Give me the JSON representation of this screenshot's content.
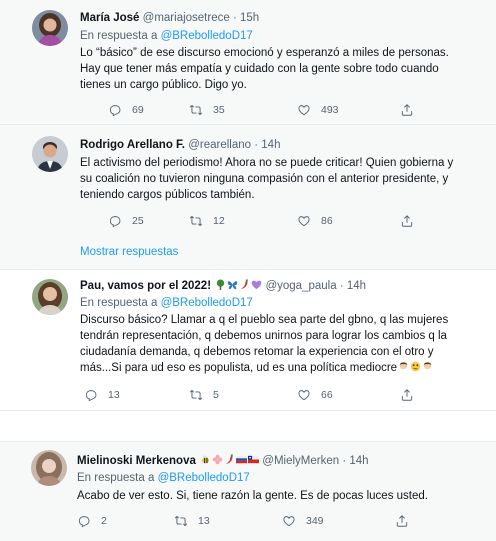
{
  "reply_prefix": "En respuesta a",
  "tweets": [
    {
      "name": "María José",
      "handle": "@mariajosetrece",
      "time": "15h",
      "reply_to": "@BRebolledoD17",
      "lines": [
        "Lo “básico” de ese discurso emocionó y esperanzó a miles de personas.",
        "Hay que tener más empatía y cuidado con la gente sobre todo cuando",
        "tienes un cargo público. Digo yo."
      ],
      "replies": "69",
      "retweets": "35",
      "likes": "493"
    },
    {
      "name": "Rodrigo Arellano F.",
      "handle": "@rearellano",
      "time": "14h",
      "reply_to": null,
      "lines": [
        "El activismo del periodismo! Ahora no se puede criticar! Quien gobierna y",
        "su coalición no tuvieron ninguna compasión con el anterior presidente, y",
        "teniendo cargos públicos también."
      ],
      "replies": "25",
      "retweets": "12",
      "likes": "86"
    },
    {
      "name": "Pau, vamos por el 2022!",
      "handle": "@yoga_paula",
      "time": "14h",
      "reply_to": "@BRebolledoD17",
      "lines": [
        "Discurso básico? Llamar a q el pueblo sea parte del gbno, q las mujeres",
        "tendrán representación, q debemos unirnos para lograr los cambios q la",
        "ciudadanía demanda, q debemos retomar la experiencia con el otro y",
        "más...Si para ud eso es populista, ud es una política mediocre"
      ],
      "replies": "13",
      "retweets": "5",
      "likes": "66"
    },
    {
      "name": "Mielinoski Merkenova",
      "handle": "@MielyMerken",
      "time": "14h",
      "reply_to": "@BRebolledoD17",
      "lines": [
        "Acabo de ver esto. Si, tiene razón la gente. Es de pocas luces usted."
      ],
      "replies": "2",
      "retweets": "13",
      "likes": "349"
    }
  ],
  "show_more": "Mostrar respuestas",
  "colors": {
    "link": "#1d9bf0",
    "muted": "#536471",
    "text": "#0f1419",
    "thread_bg": "#f7f9f9"
  },
  "icons": [
    "reply-icon",
    "retweet-icon",
    "like-icon",
    "share-icon"
  ]
}
